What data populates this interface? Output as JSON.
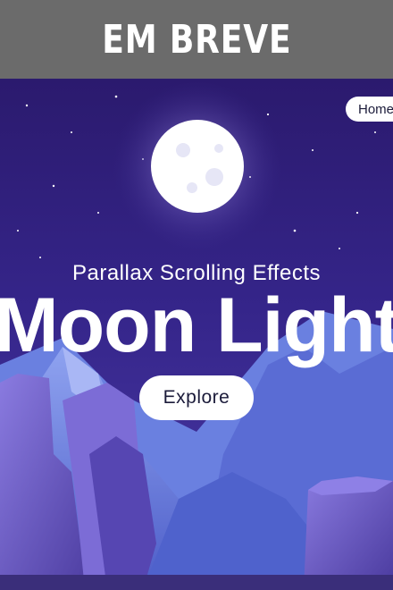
{
  "banner": {
    "text": "EM BREVE"
  },
  "nav": {
    "home_label": "Home"
  },
  "hero": {
    "subtitle": "Parallax Scrolling Effects",
    "title": "Moon Light",
    "cta_label": "Explore"
  },
  "colors": {
    "banner_bg": "#6b6b6b",
    "sky_top": "#2b1a6e",
    "sky_bottom": "#4a3aa6",
    "moon": "#ffffff",
    "mountain": "#5e6fd8",
    "rock": "#6a58c0"
  }
}
